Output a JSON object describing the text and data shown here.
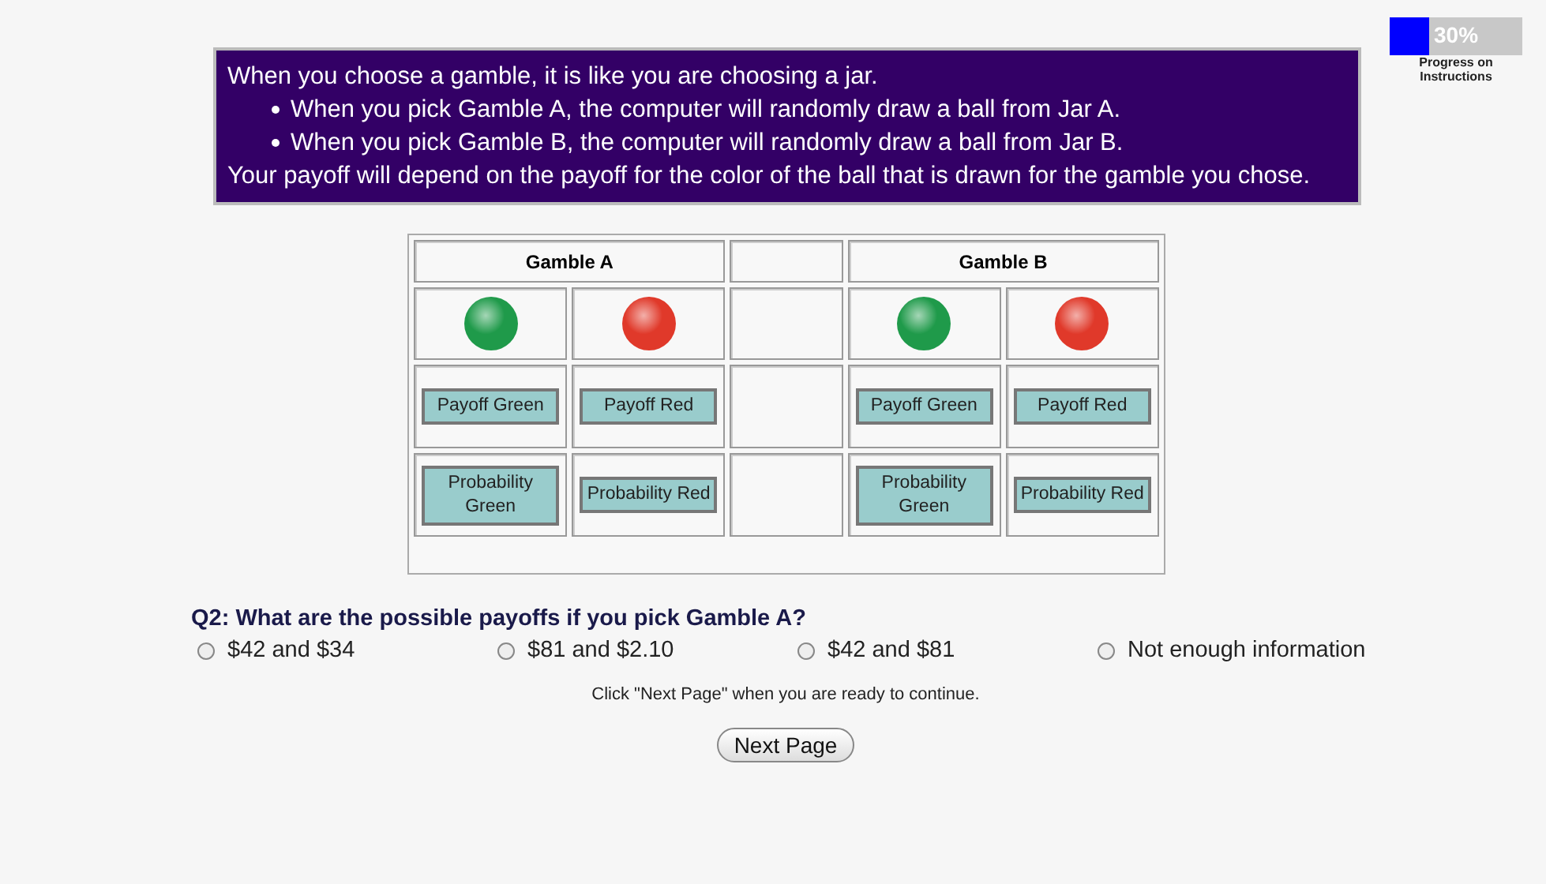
{
  "progress": {
    "level": 0.3,
    "reading": "30%",
    "label": "Progress on Instructions"
  },
  "instructions": {
    "intro": "When you choose a gamble, it is like you are choosing a jar.",
    "bullets": [
      "When you pick Gamble A, the computer will randomly draw a ball from Jar A.",
      "When you pick Gamble B, the computer will randomly draw a ball from Jar B."
    ],
    "outro": "Your payoff will depend on the payoff for the color of the ball that is drawn for the gamble you chose."
  },
  "gambles": [
    {
      "name": "Gamble A",
      "outcomes": [
        {
          "color": "#1f9a4a",
          "payoff": "Payoff Green",
          "probability": "Probability Green"
        },
        {
          "color": "#e0392a",
          "payoff": "Payoff Red",
          "probability": "Probability Red"
        }
      ]
    },
    {
      "name": "Gamble B",
      "outcomes": [
        {
          "color": "#1f9a4a",
          "payoff": "Payoff Green",
          "probability": "Probability Green"
        },
        {
          "color": "#e0392a",
          "payoff": "Payoff Red",
          "probability": "Probability Red"
        }
      ]
    }
  ],
  "question": {
    "text": "Q2: What are the possible payoffs if you pick Gamble A?",
    "options": [
      {
        "label": "$42 and $34",
        "selected": false
      },
      {
        "label": "$81 and $2.10",
        "selected": false
      },
      {
        "label": "$42 and $81",
        "selected": false
      },
      {
        "label": "Not enough information",
        "selected": false
      }
    ]
  },
  "note": "Click \"Next Page\" when you are ready to continue.",
  "next_button": "Next Page"
}
